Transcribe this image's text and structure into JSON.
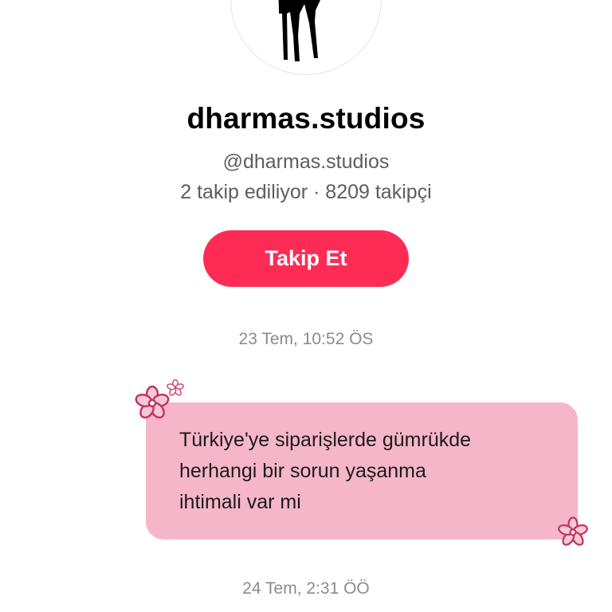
{
  "profile": {
    "display_name": "dharmas.studios",
    "username": "@dharmas.studios",
    "stats": "2 takip ediliyor · 8209 takipçi",
    "follow_label": "Takip Et"
  },
  "chat": {
    "timestamp_1": "23 Tem, 10:52 ÖS",
    "message_lines": [
      "Türkiye'ye siparişlerde gümrükde",
      "herhangi bir sorun yaşanma",
      "ihtimali var mi"
    ],
    "timestamp_2": "24 Tem, 2:31 ÖÖ"
  },
  "colors": {
    "follow_button": "#fe2c55",
    "bubble": "#f6b6c9",
    "flower_stroke": "#c0335f"
  },
  "icons": {
    "avatar": "horse-silhouette-icon",
    "decoration": "flower-icon"
  }
}
